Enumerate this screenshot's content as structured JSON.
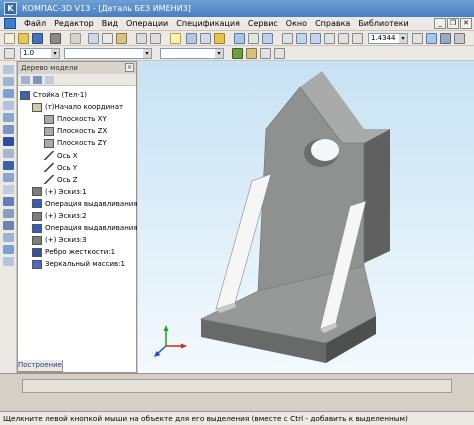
{
  "window": {
    "title": "КОМПАС-3D V13 - [Деталь БЕЗ ИМЕНИ3]"
  },
  "menu": {
    "items": [
      "Файл",
      "Редактор",
      "Вид",
      "Операции",
      "Спецификация",
      "Сервис",
      "Окно",
      "Справка",
      "Библиотеки"
    ]
  },
  "toolbar": {
    "line_scale": "1.0",
    "zoom": "1.4344"
  },
  "model_tree": {
    "panel_title": "Дерево модели",
    "items": [
      "Стойка (Тел-1)",
      "(т)Начало координат",
      "Плоскость XY",
      "Плоскость ZX",
      "Плоскость ZY",
      "Ось X",
      "Ось Y",
      "Ось Z",
      "(+) Эскиз:1",
      "Операция выдавливания",
      "(+) Эскиз:2",
      "Операция выдавливания",
      "(+) Эскиз:3",
      "Ребро жесткости:1",
      "Зеркальный массив:1"
    ],
    "bottom_tab": "Построение"
  },
  "status": {
    "message": "Щелкните левой кнопкой мыши на объекте для его выделения (вместе с Ctrl - добавить к выделенным)"
  },
  "colors": {
    "title_bar": "#4a7cc0",
    "viewport_top": "#c7e2f3",
    "model_face": "#8f9090"
  }
}
